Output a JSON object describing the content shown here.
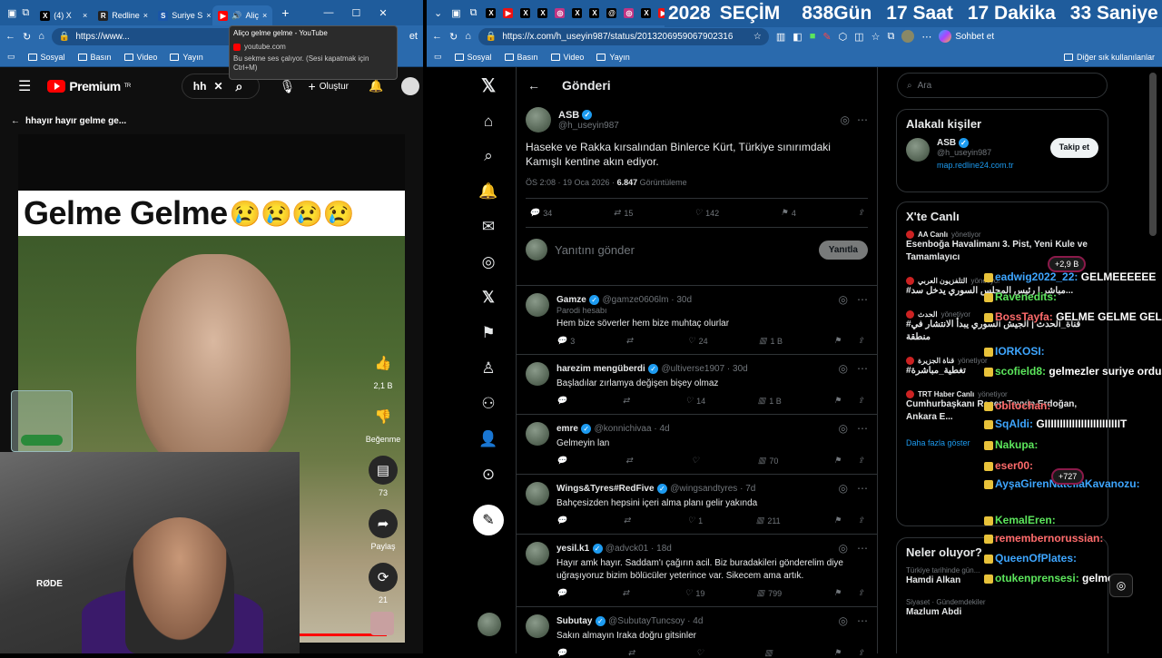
{
  "left_browser": {
    "tabs": [
      {
        "label": "(4) X",
        "icon": "x-icon"
      },
      {
        "label": "Redline",
        "icon": "redline-icon"
      },
      {
        "label": "Suriye S",
        "icon": "news-icon"
      },
      {
        "label": "Aliç",
        "icon": "youtube-icon"
      }
    ],
    "url": "https://www...",
    "bookmarks": [
      "Sosyal",
      "Basın",
      "Video",
      "Yayın"
    ],
    "new_tab": "+",
    "chat_btn": "et",
    "tooltip": {
      "title": "Aliço gelme gelme - YouTube",
      "domain": "youtube.com",
      "note": "Bu sekme ses çalıyor. (Sesi kapatmak için Ctrl+M)"
    },
    "youtube": {
      "logo": "Premium",
      "logo_sup": "TR",
      "search_value": "hh",
      "create_label": "Oluştur",
      "back_title": "hhayır hayır gelme ge...",
      "banner_text": "Gelme Gelme",
      "like_count": "2,1 B",
      "dislike_label": "Beğenme",
      "comment_count": "73",
      "share_label": "Paylaş",
      "remix_count": "21"
    }
  },
  "countdown": {
    "year": "2028",
    "title": "SEÇİM",
    "days": "838",
    "days_label": "Gün",
    "hours": "17",
    "hours_label": "Saat",
    "minutes": "17",
    "minutes_label": "Dakika",
    "seconds": "33",
    "seconds_label": "Saniye"
  },
  "right_browser": {
    "url": "https://x.com/h_useyin987/status/2013206959067902316",
    "chat_btn": "Sohbet et",
    "bookmarks": [
      "Sosyal",
      "Basın",
      "Video",
      "Yayın"
    ],
    "other_bookmarks": "Diğer sık kullanılanlar"
  },
  "x": {
    "header": "Gönderi",
    "post": {
      "name": "ASB",
      "handle": "@h_useyin987",
      "text": "Haseke ve Rakka kırsalından Binlerce Kürt, Türkiye sınırımdaki Kamışlı kentine akın ediyor.",
      "time": "ÖS 2:08 · 19 Oca 2026 ·",
      "views": "6.847",
      "views_label": "Görüntüleme",
      "replies": "34",
      "reposts": "15",
      "likes": "142",
      "bookmarks": "4"
    },
    "reply_placeholder": "Yanıtını gönder",
    "reply_button": "Yanıtla",
    "replies": [
      {
        "name": "Gamze",
        "handle": "@gamze0606lm · 30d",
        "sub": "Parodi hesabı",
        "text": "Hem bize söverler hem bize muhtaç olurlar",
        "r": "3",
        "rt": "",
        "l": "24",
        "v": "1 B"
      },
      {
        "name": "harezim mengüberdi",
        "handle": "@ultiverse1907 · 30d",
        "sub": "",
        "text": "Başladılar zırlamya değişen bişey olmaz",
        "r": "",
        "rt": "",
        "l": "14",
        "v": "1 B"
      },
      {
        "name": "emre",
        "handle": "@konnichivaa · 4d",
        "sub": "",
        "text": "Gelmeyin lan",
        "r": "",
        "rt": "",
        "l": "",
        "v": "70"
      },
      {
        "name": "Wings&Tyres#RedFive",
        "handle": "@wingsandtyres · 7d",
        "sub": "",
        "text": "Bahçesizden hepsini içeri alma planı gelir yakında",
        "r": "",
        "rt": "",
        "l": "1",
        "v": "211"
      },
      {
        "name": "yesil.k1",
        "handle": "@advck01 · 18d",
        "sub": "",
        "text": "Hayır amk hayır. Saddam'ı çağırın acil. Biz buradakileri gönderelim diye uğraşıyoruz bizim bölücüler yeterince var. Sikecem ama artık.",
        "r": "",
        "rt": "",
        "l": "19",
        "v": "799"
      },
      {
        "name": "Subutay",
        "handle": "@SubutayTuncsoy · 4d",
        "sub": "",
        "text": "Sakın almayın Iraka doğru gitsinler",
        "r": "",
        "rt": "",
        "l": "",
        "v": ""
      }
    ],
    "search_placeholder": "Ara",
    "relevant": {
      "title": "Alakalı kişiler",
      "name": "ASB",
      "handle": "@h_useyin987",
      "link": "map.redline24.com.tr",
      "follow": "Takip et"
    },
    "live": {
      "title": "X'te Canlı",
      "items": [
        {
          "host": "AA Canlı",
          "role": "yönetiyor",
          "text": "Esenboğa Havalimanı 3. Pist, Yeni Kule ve Tamamlayıcı"
        },
        {
          "host": "التلفزيون العربي",
          "role": "yönetiyor",
          "text": "#مباشر | رئيس المجلس السوري يدخل سد..."
        },
        {
          "host": "الحدث",
          "role": "yönetiyor",
          "text": "#قناة_الحدث | الجيش السوري يبدأ الانتشار في منطقة"
        },
        {
          "host": "قناة الجزيرة",
          "role": "yönetiyor",
          "text": "#تغطية_مباشرة"
        },
        {
          "host": "TRT Haber Canlı",
          "role": "yönetiyor",
          "text": "Cumhurbaşkanı Recep Tayyip Erdoğan, Ankara E..."
        }
      ],
      "more": "Daha fazla göster",
      "badge1": "+2,9 B",
      "badge2": "+727"
    },
    "whats": {
      "title": "Neler oluyor?",
      "items": [
        {
          "meta": "Türkiye tarihinde gün...",
          "topic": "Hamdi Alkan"
        },
        {
          "meta": "Siyaset · Gündemdekiler",
          "topic": "Mazlum Abdi"
        }
      ]
    }
  },
  "chat": [
    {
      "user": "eadwig2022_22:",
      "msg": "GELMEEEEEE"
    },
    {
      "user": "Ravenedits:",
      "msg": ""
    },
    {
      "user": "BossTayfa:",
      "msg": "GELME GELME GELMEEE"
    },
    {
      "user": "IORKOSI:",
      "msg": ""
    },
    {
      "user": "scofield8:",
      "msg": "gelmezler suriye ordusu bakacak"
    },
    {
      "user": "obitochan:",
      "msg": ""
    },
    {
      "user": "SqAldi:",
      "msg": "GIIIIIIIIIIIIIIIIIIIIIIIIIT"
    },
    {
      "user": "Nakupa:",
      "msg": ""
    },
    {
      "user": "eser00:",
      "msg": ""
    },
    {
      "user": "AyşaGirenNatellaKavanozu:",
      "msg": ""
    },
    {
      "user": "KemalEren:",
      "msg": ""
    },
    {
      "user": "remembernorussian:",
      "msg": ""
    },
    {
      "user": "QueenOfPlates:",
      "msg": ""
    },
    {
      "user": "otukenprensesi:",
      "msg": "gelmeee"
    }
  ]
}
